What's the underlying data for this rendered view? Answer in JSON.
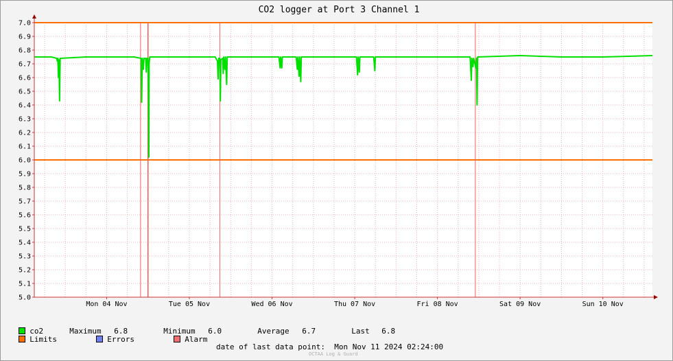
{
  "chart_data": {
    "type": "line",
    "title": "CO2 logger at Port 3 Channel 1",
    "ylim": [
      5.0,
      7.0
    ],
    "y_ticks": [
      "7.0",
      "6.9",
      "6.8",
      "6.7",
      "6.6",
      "6.5",
      "6.4",
      "6.3",
      "6.2",
      "6.1",
      "6.0",
      "5.9",
      "5.8",
      "5.7",
      "5.6",
      "5.5",
      "5.4",
      "5.3",
      "5.2",
      "5.1",
      "5.0"
    ],
    "x_start": "2024-11-03 15:00",
    "x_end": "2024-11-11 02:24",
    "x_tick_labels": [
      {
        "time": "2024-11-04 00:00",
        "label": "Mon 04 Nov"
      },
      {
        "time": "2024-11-05 00:00",
        "label": "Tue 05 Nov"
      },
      {
        "time": "2024-11-06 00:00",
        "label": "Wed 06 Nov"
      },
      {
        "time": "2024-11-07 00:00",
        "label": "Thu 07 Nov"
      },
      {
        "time": "2024-11-08 00:00",
        "label": "Fri 08 Nov"
      },
      {
        "time": "2024-11-09 00:00",
        "label": "Sat 09 Nov"
      },
      {
        "time": "2024-11-10 00:00",
        "label": "Sun 10 Nov"
      }
    ],
    "limits": [
      7.0,
      6.0
    ],
    "alarm_lines": [
      "2024-11-04 21:50",
      "2024-11-05 00:00",
      "2024-11-05 20:50",
      "2024-11-08 23:00"
    ],
    "series": [
      {
        "name": "co2",
        "color": "#00e000",
        "points": [
          [
            "2024-11-03 15:00",
            6.75
          ],
          [
            "2024-11-03 20:00",
            6.75
          ],
          [
            "2024-11-03 21:30",
            6.74
          ],
          [
            "2024-11-03 21:40",
            6.72
          ],
          [
            "2024-11-03 21:50",
            6.74
          ],
          [
            "2024-11-03 22:00",
            6.6
          ],
          [
            "2024-11-03 22:10",
            6.73
          ],
          [
            "2024-11-03 22:20",
            6.43
          ],
          [
            "2024-11-03 22:30",
            6.74
          ],
          [
            "2024-11-04 06:00",
            6.75
          ],
          [
            "2024-11-04 15:00",
            6.75
          ],
          [
            "2024-11-04 20:00",
            6.75
          ],
          [
            "2024-11-04 22:00",
            6.74
          ],
          [
            "2024-11-04 22:10",
            6.42
          ],
          [
            "2024-11-04 22:20",
            6.74
          ],
          [
            "2024-11-04 22:40",
            6.66
          ],
          [
            "2024-11-04 22:50",
            6.74
          ],
          [
            "2024-11-04 23:20",
            6.74
          ],
          [
            "2024-11-04 23:30",
            6.64
          ],
          [
            "2024-11-04 23:40",
            6.74
          ],
          [
            "2024-11-05 00:00",
            6.74
          ],
          [
            "2024-11-05 00:10",
            6.42
          ],
          [
            "2024-11-05 00:15",
            6.02
          ],
          [
            "2024-11-05 00:20",
            6.7
          ],
          [
            "2024-11-05 00:30",
            6.75
          ],
          [
            "2024-11-05 10:00",
            6.75
          ],
          [
            "2024-11-05 19:30",
            6.75
          ],
          [
            "2024-11-05 20:10",
            6.72
          ],
          [
            "2024-11-05 20:20",
            6.59
          ],
          [
            "2024-11-05 20:30",
            6.74
          ],
          [
            "2024-11-05 20:50",
            6.74
          ],
          [
            "2024-11-05 21:00",
            6.43
          ],
          [
            "2024-11-05 21:10",
            6.73
          ],
          [
            "2024-11-05 21:40",
            6.74
          ],
          [
            "2024-11-05 21:50",
            6.63
          ],
          [
            "2024-11-05 22:00",
            6.75
          ],
          [
            "2024-11-05 22:20",
            6.66
          ],
          [
            "2024-11-05 22:30",
            6.75
          ],
          [
            "2024-11-05 22:50",
            6.55
          ],
          [
            "2024-11-05 23:00",
            6.75
          ],
          [
            "2024-11-06 08:00",
            6.75
          ],
          [
            "2024-11-06 14:00",
            6.75
          ],
          [
            "2024-11-06 14:20",
            6.67
          ],
          [
            "2024-11-06 14:30",
            6.75
          ],
          [
            "2024-11-06 14:50",
            6.67
          ],
          [
            "2024-11-06 15:00",
            6.75
          ],
          [
            "2024-11-06 19:00",
            6.75
          ],
          [
            "2024-11-06 19:20",
            6.66
          ],
          [
            "2024-11-06 19:30",
            6.75
          ],
          [
            "2024-11-06 19:50",
            6.61
          ],
          [
            "2024-11-06 20:00",
            6.75
          ],
          [
            "2024-11-06 20:20",
            6.57
          ],
          [
            "2024-11-06 20:30",
            6.75
          ],
          [
            "2024-11-07 08:00",
            6.75
          ],
          [
            "2024-11-07 12:30",
            6.75
          ],
          [
            "2024-11-07 12:50",
            6.62
          ],
          [
            "2024-11-07 13:00",
            6.75
          ],
          [
            "2024-11-07 13:20",
            6.64
          ],
          [
            "2024-11-07 13:30",
            6.75
          ],
          [
            "2024-11-07 17:30",
            6.75
          ],
          [
            "2024-11-07 17:50",
            6.65
          ],
          [
            "2024-11-07 18:00",
            6.75
          ],
          [
            "2024-11-08 08:00",
            6.75
          ],
          [
            "2024-11-08 21:30",
            6.75
          ],
          [
            "2024-11-08 21:50",
            6.58
          ],
          [
            "2024-11-08 22:00",
            6.74
          ],
          [
            "2024-11-08 22:20",
            6.68
          ],
          [
            "2024-11-08 22:30",
            6.74
          ],
          [
            "2024-11-08 23:10",
            6.67
          ],
          [
            "2024-11-08 23:20",
            6.74
          ],
          [
            "2024-11-08 23:30",
            6.4
          ],
          [
            "2024-11-08 23:40",
            6.75
          ],
          [
            "2024-11-09 12:00",
            6.76
          ],
          [
            "2024-11-10 00:00",
            6.75
          ],
          [
            "2024-11-10 12:00",
            6.75
          ],
          [
            "2024-11-11 02:24",
            6.76
          ]
        ]
      }
    ]
  },
  "legend": {
    "co2": {
      "label": "co2",
      "color": "#00e000",
      "max_label": "Maximum",
      "max_value": "6.8",
      "min_label": "Minimum",
      "min_value": "6.0",
      "avg_label": "Average",
      "avg_value": "6.7",
      "last_label": "Last",
      "last_value": "6.8"
    },
    "limits": {
      "label": "Limits",
      "color": "#ff7000"
    },
    "errors": {
      "label": "Errors",
      "color": "#7080f0"
    },
    "alarm": {
      "label": "Alarm",
      "color": "#f07070"
    }
  },
  "footer": {
    "last_point_label": "date of last data point:",
    "last_point_value": "Mon Nov 11 2024 02:24:00",
    "credit": "OCTAA Log & Guard"
  }
}
